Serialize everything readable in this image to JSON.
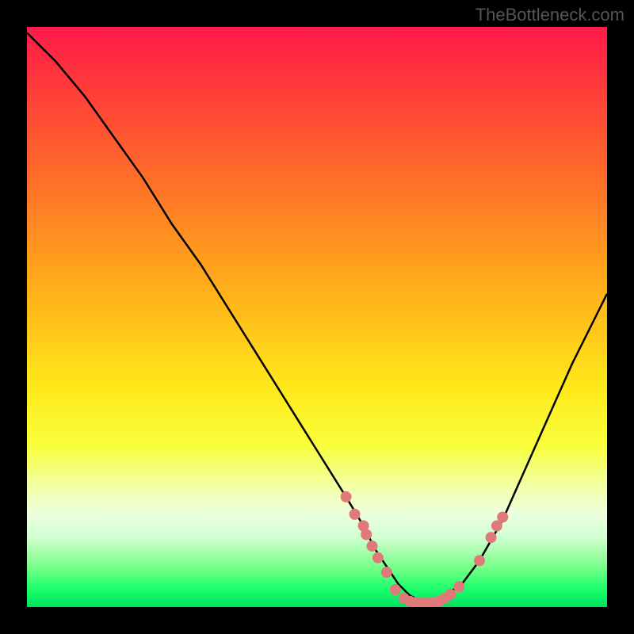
{
  "watermark": "TheBottleneck.com",
  "chart_data": {
    "type": "line",
    "title": "",
    "xlabel": "",
    "ylabel": "",
    "xlim": [
      0,
      100
    ],
    "ylim": [
      0,
      100
    ],
    "grid": false,
    "series": [
      {
        "name": "curve",
        "x": [
          0,
          5,
          10,
          15,
          20,
          25,
          30,
          35,
          40,
          45,
          50,
          55,
          58,
          60,
          62,
          64,
          66,
          68,
          70,
          72,
          75,
          78,
          82,
          86,
          90,
          94,
          98,
          100
        ],
        "y": [
          99,
          94,
          88,
          81,
          74,
          66,
          59,
          51,
          43,
          35,
          27,
          19,
          14,
          10,
          7,
          4,
          2,
          1,
          1,
          2,
          4,
          8,
          15,
          24,
          33,
          42,
          50,
          54
        ]
      }
    ],
    "markers": {
      "name": "dots",
      "color": "#e07a7a",
      "points": [
        {
          "x": 55,
          "y": 19
        },
        {
          "x": 56.5,
          "y": 16
        },
        {
          "x": 58,
          "y": 14
        },
        {
          "x": 58.5,
          "y": 12.5
        },
        {
          "x": 59.5,
          "y": 10.5
        },
        {
          "x": 60.5,
          "y": 8.5
        },
        {
          "x": 62,
          "y": 6
        },
        {
          "x": 63.5,
          "y": 3
        },
        {
          "x": 65,
          "y": 1.5
        },
        {
          "x": 66,
          "y": 1
        },
        {
          "x": 67,
          "y": 0.8
        },
        {
          "x": 68,
          "y": 0.7
        },
        {
          "x": 69,
          "y": 0.7
        },
        {
          "x": 70,
          "y": 0.8
        },
        {
          "x": 71,
          "y": 1
        },
        {
          "x": 72,
          "y": 1.5
        },
        {
          "x": 73,
          "y": 2.2
        },
        {
          "x": 74.5,
          "y": 3.5
        },
        {
          "x": 78,
          "y": 8
        },
        {
          "x": 80,
          "y": 12
        },
        {
          "x": 81,
          "y": 14
        },
        {
          "x": 82,
          "y": 15.5
        }
      ]
    },
    "gradient_bands": [
      {
        "color": "#ff1a4a",
        "stop": 0
      },
      {
        "color": "#ffae1a",
        "stop": 45
      },
      {
        "color": "#ffe81a",
        "stop": 65
      },
      {
        "color": "#00e060",
        "stop": 100
      }
    ]
  }
}
